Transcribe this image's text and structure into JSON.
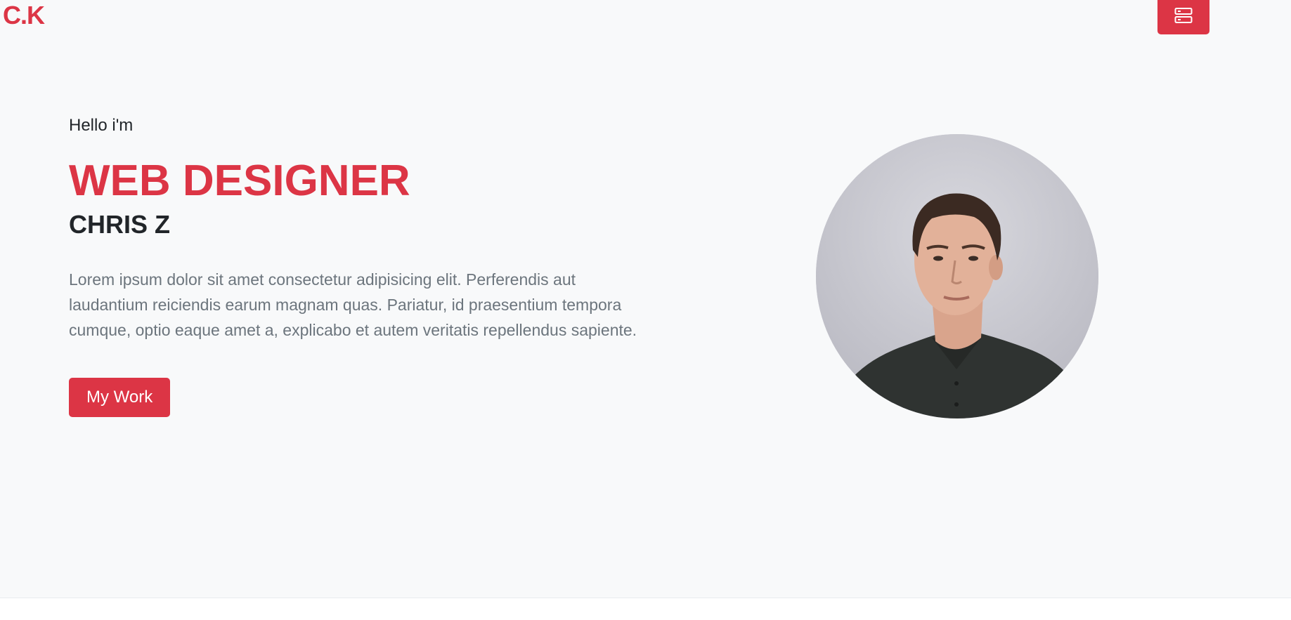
{
  "header": {
    "brand": "C.K",
    "menu_icon": "server-stack-icon"
  },
  "hero": {
    "greeting": "Hello i'm",
    "role": "WEB DESIGNER",
    "name": "CHRIS Z",
    "bio": "Lorem ipsum dolor sit amet consectetur adipisicing elit. Perferendis aut laudantium reiciendis earum magnam quas. Pariatur, id praesentium tempora cumque, optio eaque amet a, explicabo et autem veritatis repellendus sapiente.",
    "cta_label": "My Work",
    "portrait_icon": "profile-photo"
  },
  "colors": {
    "accent": "#dc3545",
    "background": "#f8f9fa",
    "heading": "#212529",
    "muted": "#6c757d"
  }
}
